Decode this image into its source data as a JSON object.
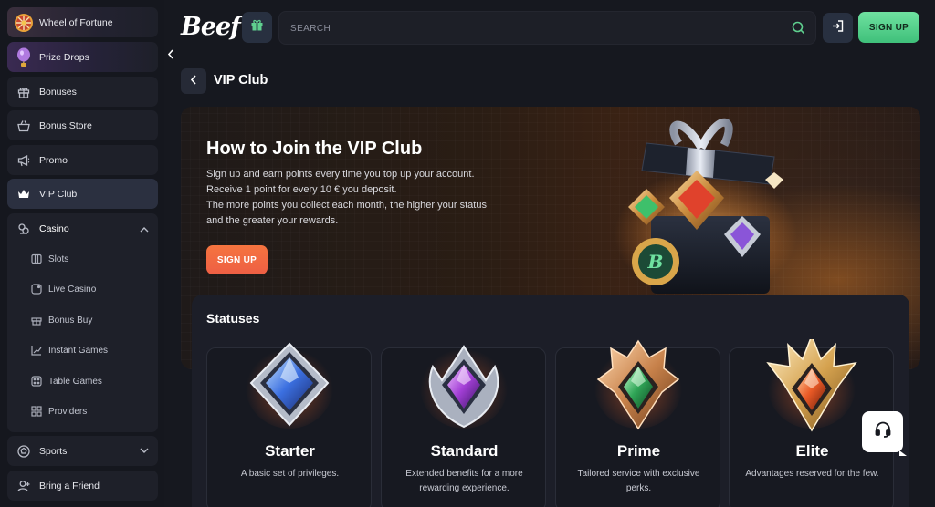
{
  "sidebar": {
    "items": [
      {
        "label": "Wheel of Fortune",
        "icon": "wheel-icon"
      },
      {
        "label": "Prize Drops",
        "icon": "balloon-icon"
      },
      {
        "label": "Bonuses",
        "icon": "gift-icon"
      },
      {
        "label": "Bonus Store",
        "icon": "basket-icon"
      },
      {
        "label": "Promo",
        "icon": "megaphone-icon"
      },
      {
        "label": "VIP Club",
        "icon": "crown-icon",
        "active": true
      }
    ],
    "casino": {
      "label": "Casino",
      "icon": "casino-icon",
      "expanded": true,
      "subitems": [
        {
          "label": "Slots",
          "icon": "slots-icon"
        },
        {
          "label": "Live Casino",
          "icon": "live-icon"
        },
        {
          "label": "Bonus Buy",
          "icon": "bonus-buy-icon"
        },
        {
          "label": "Instant Games",
          "icon": "chart-icon"
        },
        {
          "label": "Table Games",
          "icon": "dice-icon"
        },
        {
          "label": "Providers",
          "icon": "grid-icon"
        }
      ]
    },
    "sports": {
      "label": "Sports",
      "icon": "ball-icon"
    },
    "bring_friend": {
      "label": "Bring a Friend",
      "icon": "user-icon"
    }
  },
  "header": {
    "logo": "Beef",
    "search_placeholder": "SEARCH",
    "signup_label": "SIGN UP"
  },
  "page": {
    "title": "VIP Club"
  },
  "hero": {
    "title": "How to Join the VIP Club",
    "lines": [
      "Sign up and earn points every time you top up your account.",
      "Receive 1 point for every 10 € you deposit.",
      "The more points you collect each month, the higher your status",
      "and the greater your rewards."
    ],
    "signup_label": "SIGN UP"
  },
  "statuses": {
    "title": "Statuses",
    "cards": [
      {
        "name": "Starter",
        "description": "A basic set of privileges."
      },
      {
        "name": "Standard",
        "description": "Extended benefits for a more rewarding experience."
      },
      {
        "name": "Prime",
        "description": "Tailored service with exclusive perks."
      },
      {
        "name": "Elite",
        "description": "Advantages reserved for the few."
      }
    ]
  },
  "colors": {
    "accent_green": "#4fcf86",
    "accent_orange": "#f26a41",
    "background": "#16181f"
  }
}
